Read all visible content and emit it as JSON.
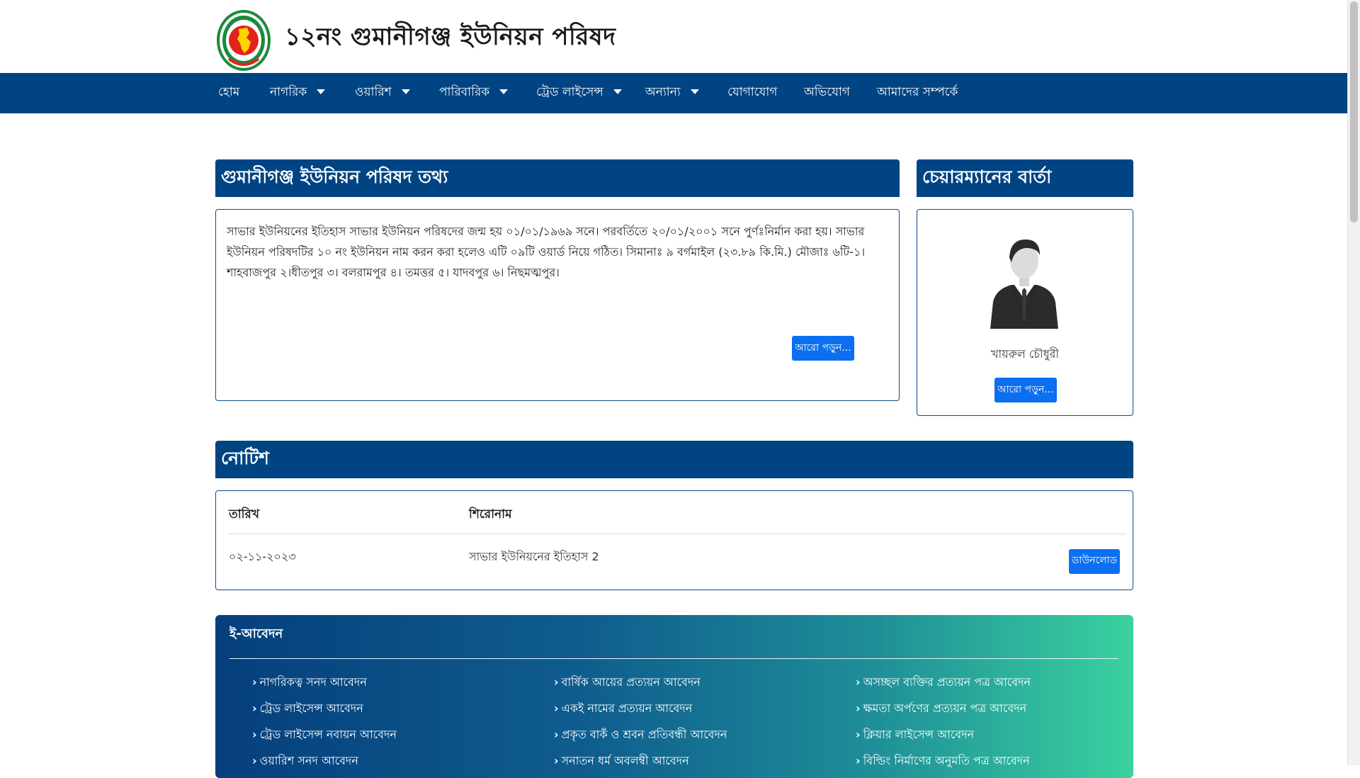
{
  "site": {
    "title": "১২নং গুমানীগঞ্জ ইউনিয়ন পরিষদ"
  },
  "colors": {
    "primary": "#004483",
    "button": "#0b6ff0",
    "gradient_end": "#3ad19f"
  },
  "nav": [
    {
      "label": "হোম",
      "dropdown": false
    },
    {
      "label": "নাগরিক",
      "dropdown": true
    },
    {
      "label": "ওয়ারিশ",
      "dropdown": true
    },
    {
      "label": "পারিবারিক",
      "dropdown": true
    },
    {
      "label": "ট্রেড লাইসেন্স",
      "dropdown": true
    },
    {
      "label": "অন্যান্য",
      "dropdown": true
    },
    {
      "label": "যোগাযোগ",
      "dropdown": false
    },
    {
      "label": "অভিযোগ",
      "dropdown": false
    },
    {
      "label": "আমাদের সম্পর্কে",
      "dropdown": false
    }
  ],
  "info": {
    "heading": "গুমানীগঞ্জ ইউনিয়ন পরিষদ তথ্য",
    "text": "সাভার ইউনিয়নের ইতিহাস সাভার ইউনিয়ন পরিষদের জন্ম হয় ০১/০১/১৯৬৯ সনে। পরবর্তিতে ২০/০১/২০০১ সনে পুর্ণঃনির্মান করা হয়। সাভার ইউনিয়ন পরিষদটির ১০ নং ইউনিয়ন নাম করন করা হলেও এটি ০৯টি ওয়ার্ড নিয়ে গঠিত। সিমানাঃ ৯ বর্গমাইল (২৩.৮৯ কি.মি.) মৌজাঃ ৬টি-১। শাহবাজপুর ২।ধীতপুর ৩। বলরামপুর ৪। তমত্তর ৫। যাদবপুর ৬। নিছমত্মপুর।",
    "read_more": "আরো পড়ুন..."
  },
  "chairman": {
    "heading": "চেয়ারম্যানের বার্তা",
    "name": "খায়রুল চৌধুরী",
    "read_more": "আরো পড়ুন..."
  },
  "notice": {
    "heading": "নোটিশ",
    "columns": [
      "তারিখ",
      "শিরোনাম"
    ],
    "rows": [
      {
        "date": "০২-১১-২০২৩",
        "title": "সাভার ইউনিয়নের ইতিহাস 2",
        "action": "ডাউনলোড"
      }
    ]
  },
  "eapplication": {
    "heading": "ই-আবেদন",
    "columns": [
      [
        "নাগরিকত্ব সনদ আবেদন",
        "ট্রেড লাইসেন্স আবেদন",
        "ট্রেড লাইসেন্স নবায়ন আবেদন",
        "ওয়ারিশ সনদ আবেদন"
      ],
      [
        "বার্ষিক আয়ের প্রত্যয়ন আবেদন",
        "একই নামের প্রত্যয়ন আবেদন",
        "প্রকৃত বাকঁ ও শ্রবন প্রতিবন্ধী আবেদন",
        "সনাতন ধর্ম অবলম্বী আবেদন"
      ],
      [
        "অসচ্ছল ব্যক্তির প্রত্যয়ন পত্র আবেদন",
        "ক্ষমতা অর্পণের প্রত্যয়ন পত্র আবেদন",
        "ক্লিয়ার লাইসেন্স আবেদন",
        "বিল্ডিং নির্মাণের অনুমতি পত্র আবেদন"
      ]
    ]
  }
}
